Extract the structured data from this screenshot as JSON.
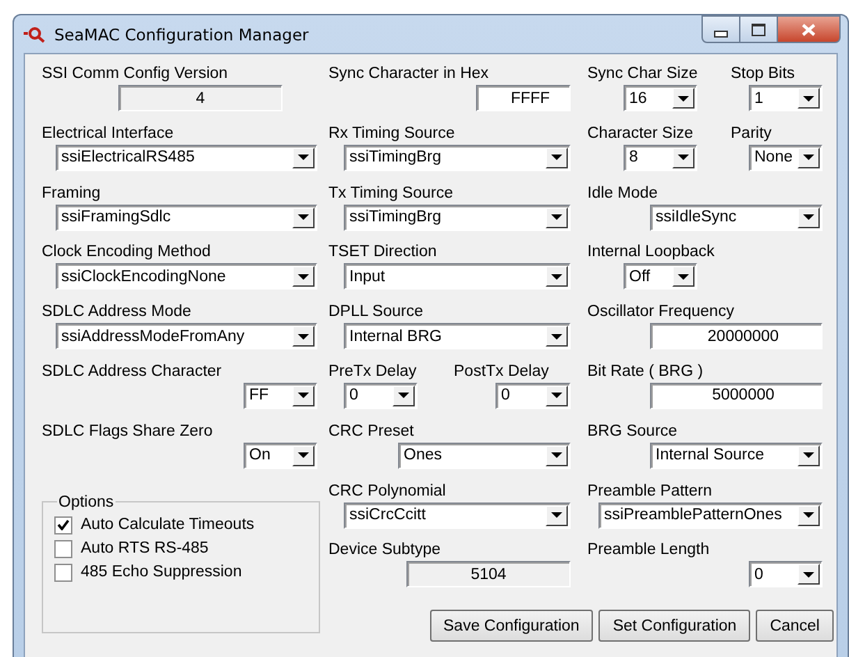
{
  "window": {
    "title": "SeaMAC Configuration Manager"
  },
  "columns": [
    [
      {
        "kind": "readonly",
        "label": "SSI Comm Config Version",
        "value": "4"
      },
      {
        "kind": "combo",
        "label": "Electrical Interface",
        "value": "ssiElectricalRS485"
      },
      {
        "kind": "combo",
        "label": "Framing",
        "value": "ssiFramingSdlc"
      },
      {
        "kind": "combo",
        "label": "Clock Encoding Method",
        "value": "ssiClockEncodingNone"
      },
      {
        "kind": "combo",
        "label": "SDLC Address Mode",
        "value": "ssiAddressModeFromAny"
      },
      {
        "kind": "combo",
        "label": "SDLC Address Character",
        "value": "FF"
      },
      {
        "kind": "combo",
        "label": "SDLC Flags Share Zero",
        "value": "On"
      }
    ],
    [
      {
        "kind": "text",
        "label": "Sync Character in Hex",
        "value": "FFFF"
      },
      {
        "kind": "combo",
        "label": "Rx Timing Source",
        "value": "ssiTimingBrg"
      },
      {
        "kind": "combo",
        "label": "Tx Timing Source",
        "value": "ssiTimingBrg"
      },
      {
        "kind": "combo",
        "label": "TSET Direction",
        "value": "Input"
      },
      {
        "kind": "combo",
        "label": "DPLL Source",
        "value": "Internal BRG"
      },
      {
        "kind": "pair",
        "items": [
          {
            "kind": "combo",
            "label": "PreTx Delay",
            "value": "0"
          },
          {
            "kind": "combo",
            "label": "PostTx Delay",
            "value": "0"
          }
        ]
      },
      {
        "kind": "combo",
        "label": "CRC Preset",
        "value": "Ones"
      },
      {
        "kind": "combo",
        "label": "CRC Polynomial",
        "value": "ssiCrcCcitt"
      },
      {
        "kind": "readonly",
        "label": "Device Subtype",
        "value": "5104"
      }
    ],
    [
      {
        "kind": "pair",
        "items": [
          {
            "kind": "combo",
            "label": "Sync Char Size",
            "value": "16"
          },
          {
            "kind": "combo",
            "label": "Stop Bits",
            "value": "1"
          }
        ]
      },
      {
        "kind": "pair",
        "items": [
          {
            "kind": "combo",
            "label": "Character Size",
            "value": "8"
          },
          {
            "kind": "combo",
            "label": "Parity",
            "value": "None"
          }
        ]
      },
      {
        "kind": "combo",
        "label": "Idle Mode",
        "value": "ssiIdleSync"
      },
      {
        "kind": "combo",
        "label": "Internal Loopback",
        "value": "Off"
      },
      {
        "kind": "text",
        "label": "Oscillator Frequency",
        "value": "20000000"
      },
      {
        "kind": "text",
        "label": "Bit Rate ( BRG )",
        "value": "5000000"
      },
      {
        "kind": "combo",
        "label": "BRG Source",
        "value": "Internal Source"
      },
      {
        "kind": "combo",
        "label": "Preamble Pattern",
        "value": "ssiPreamblePatternOnes"
      },
      {
        "kind": "combo",
        "label": "Preamble Length",
        "value": "0"
      }
    ]
  ],
  "options": {
    "title": "Options",
    "items": [
      {
        "label": "Auto Calculate Timeouts",
        "checked": true
      },
      {
        "label": "Auto RTS RS-485",
        "checked": false
      },
      {
        "label": "485 Echo Suppression",
        "checked": false
      }
    ]
  },
  "buttons": [
    "Save Configuration",
    "Set Configuration",
    "Cancel"
  ]
}
